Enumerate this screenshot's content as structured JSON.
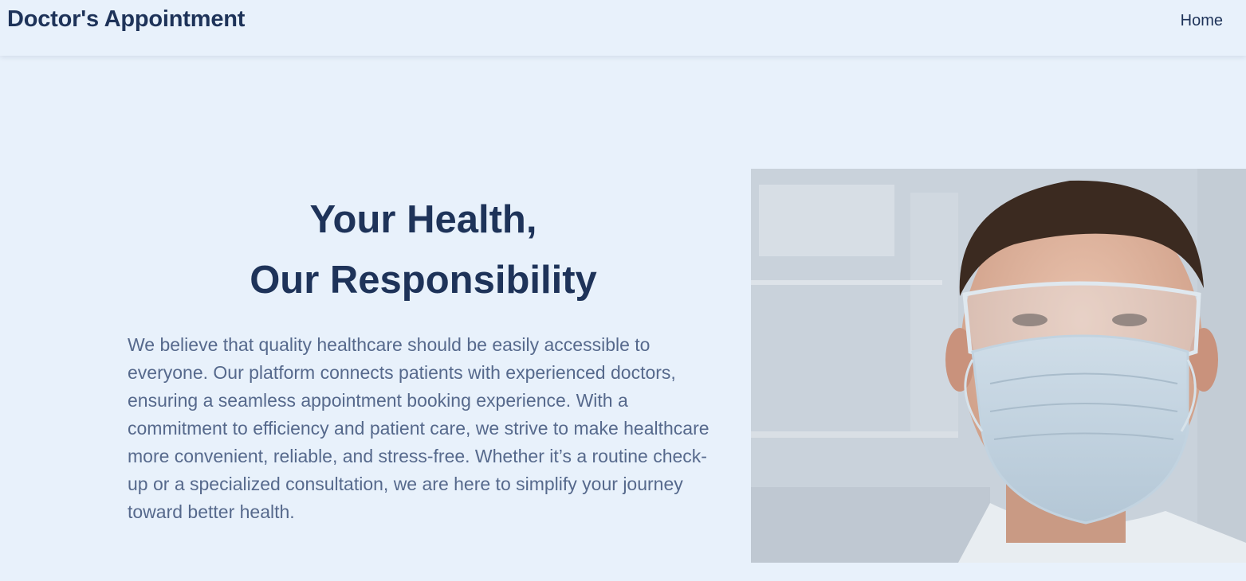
{
  "navbar": {
    "brand": "Doctor's Appointment",
    "links": [
      {
        "label": "Home"
      }
    ]
  },
  "hero": {
    "title_line1": "Your Health,",
    "title_line2": "Our Responsibility",
    "description": "We believe that quality healthcare should be easily accessible to everyone. Our platform connects patients with experienced doctors, ensuring a seamless appointment booking experience. With a commitment to efficiency and patient care, we strive to make healthcare more convenient, reliable, and stress-free. Whether it’s a routine check-up or a specialized consultation, we are here to simplify your journey toward better health."
  },
  "colors": {
    "background": "#e8f1fb",
    "heading": "#1e3359",
    "body_text": "#56698c"
  }
}
